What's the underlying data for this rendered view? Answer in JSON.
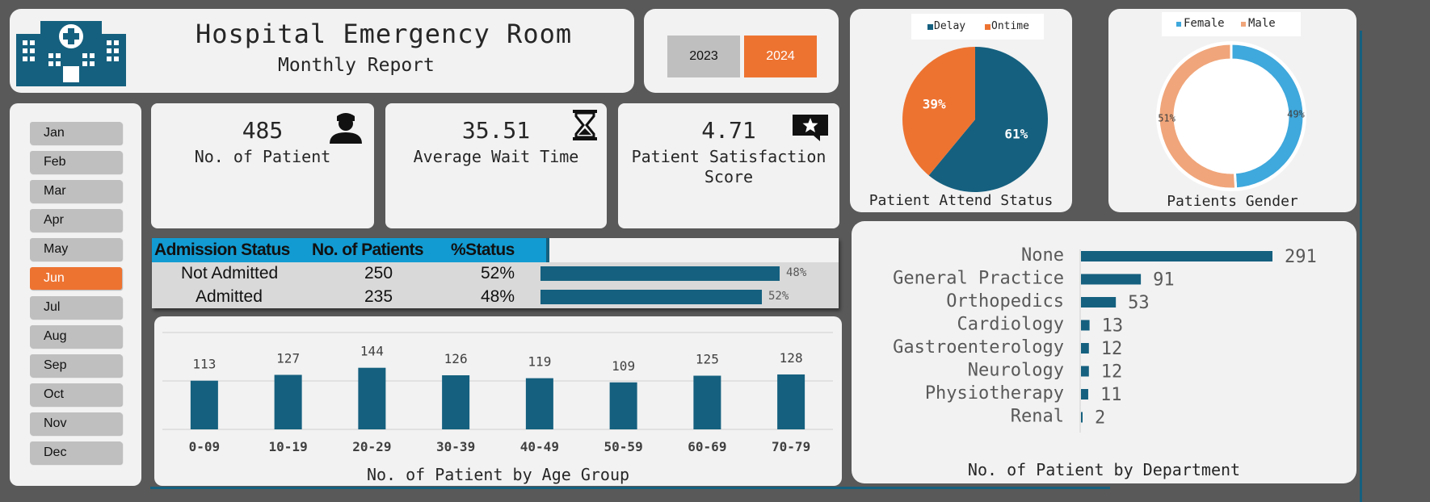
{
  "header": {
    "title": "Hospital Emergency Room",
    "subtitle": "Monthly Report"
  },
  "years": [
    {
      "label": "2023",
      "active": false
    },
    {
      "label": "2024",
      "active": true
    }
  ],
  "months": [
    {
      "label": "Jan",
      "active": false
    },
    {
      "label": "Feb",
      "active": false
    },
    {
      "label": "Mar",
      "active": false
    },
    {
      "label": "Apr",
      "active": false
    },
    {
      "label": "May",
      "active": false
    },
    {
      "label": "Jun",
      "active": true
    },
    {
      "label": "Jul",
      "active": false
    },
    {
      "label": "Aug",
      "active": false
    },
    {
      "label": "Sep",
      "active": false
    },
    {
      "label": "Oct",
      "active": false
    },
    {
      "label": "Nov",
      "active": false
    },
    {
      "label": "Dec",
      "active": false
    }
  ],
  "kpis": {
    "patients": {
      "value": "485",
      "label": "No. of Patient",
      "icon": "patient-icon"
    },
    "wait": {
      "value": "35.51",
      "label": "Average Wait Time",
      "icon": "hourglass-icon"
    },
    "satisfaction": {
      "value": "4.71",
      "label": "Patient Satisfaction Score",
      "icon": "star-review-icon"
    }
  },
  "admission": {
    "headers": [
      "Admission Status",
      "No. of Patients",
      "%Status"
    ],
    "rows": [
      {
        "status": "Not Admitted",
        "count": "250",
        "pct": "52%",
        "bar_fraction": 0.52,
        "bar_label": "48%"
      },
      {
        "status": "Admitted",
        "count": "235",
        "pct": "48%",
        "bar_fraction": 0.48,
        "bar_label": "52%"
      }
    ]
  },
  "colors": {
    "primary": "#15607f",
    "accent": "#ed7331",
    "header_blue": "#129bd2",
    "female": "#3fa8dc",
    "male": "#f0a57a"
  },
  "chart_data": [
    {
      "id": "age",
      "type": "bar",
      "title": "No. of Patient by Age Group",
      "categories": [
        "0-09",
        "10-19",
        "20-29",
        "30-39",
        "40-49",
        "50-59",
        "60-69",
        "70-79"
      ],
      "values": [
        113,
        127,
        144,
        126,
        119,
        109,
        125,
        128
      ],
      "ylim": [
        0,
        200
      ],
      "grid": true
    },
    {
      "id": "attend",
      "type": "pie",
      "title": "Patient Attend Status",
      "categories": [
        "Delay",
        "Ontime"
      ],
      "values": [
        61,
        39
      ],
      "labels": [
        "61%",
        "39%"
      ],
      "legend": "top"
    },
    {
      "id": "gender",
      "type": "pie",
      "title": "Patients Gender",
      "categories": [
        "Female",
        "Male"
      ],
      "values": [
        49,
        51
      ],
      "labels": [
        "49%",
        "51%"
      ],
      "legend": "top"
    },
    {
      "id": "dept",
      "type": "bar",
      "orientation": "horizontal",
      "title": "No. of Patient by Department",
      "categories": [
        "None",
        "General Practice",
        "Orthopedics",
        "Cardiology",
        "Gastroenterology",
        "Neurology",
        "Physiotherapy",
        "Renal"
      ],
      "values": [
        291,
        91,
        53,
        13,
        12,
        12,
        11,
        2
      ]
    }
  ]
}
